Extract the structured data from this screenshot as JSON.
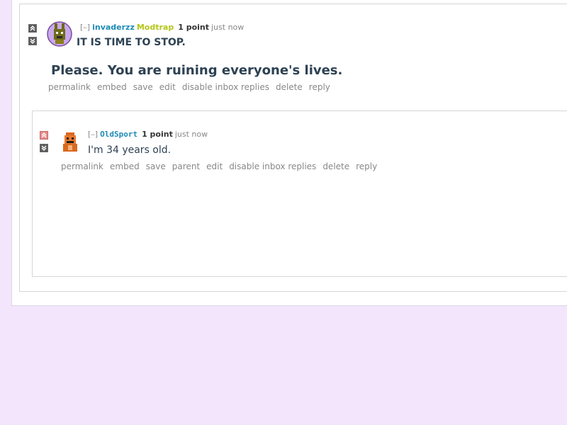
{
  "parent_comment": {
    "collapse": "[–]",
    "author": "invaderzz",
    "flair": "Modtrap",
    "score": "1 point",
    "time": "just now",
    "line1": "IT IS TIME TO STOP.",
    "line2": "Please. You are ruining everyone's lives.",
    "actions": [
      "permalink",
      "embed",
      "save",
      "edit",
      "disable inbox replies",
      "delete",
      "reply"
    ]
  },
  "child_comment": {
    "collapse": "[–]",
    "author": "OldSport",
    "score": "1 point",
    "time": "just now",
    "text": "I'm 34 years old.",
    "actions": [
      "permalink",
      "embed",
      "save",
      "parent",
      "edit",
      "disable inbox replies",
      "delete",
      "reply"
    ]
  },
  "colors": {
    "background": "#f3e6fc",
    "author": "#1e8bb5",
    "flair": "#b4c61a",
    "upvoted": "#e58b8b"
  }
}
